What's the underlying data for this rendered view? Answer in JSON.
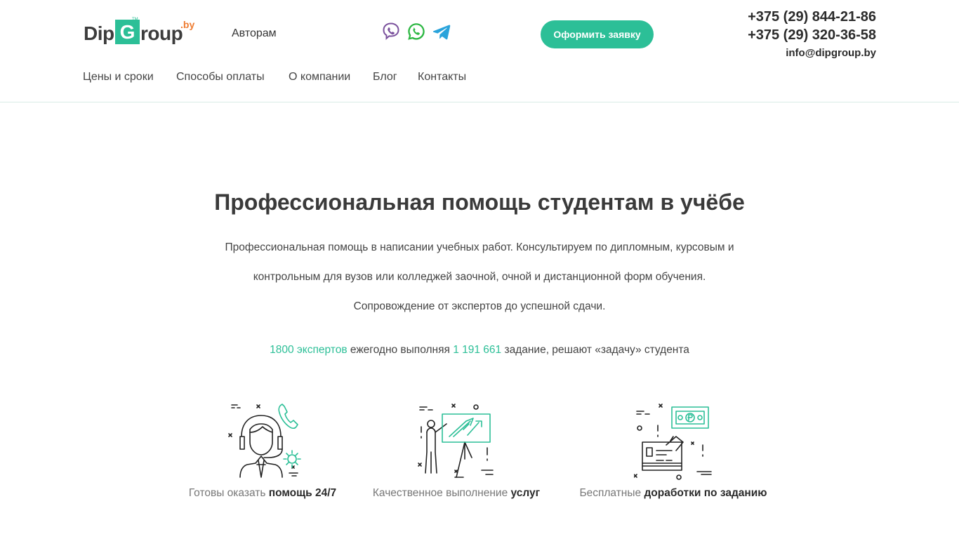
{
  "logo": {
    "part1": "Dip",
    "letter": "G",
    "registered": "TM",
    "part2": "roup",
    "suffix": ".by"
  },
  "header": {
    "authors_link": "Авторам",
    "order_button": "Оформить заявку",
    "phones": [
      "+375 (29) 844-21-86",
      "+375 (29) 320-36-58"
    ],
    "email": "info@dipgroup.by",
    "messengers": [
      "viber-icon",
      "whatsapp-icon",
      "telegram-icon"
    ]
  },
  "nav": {
    "items": [
      {
        "label": "Цены и сроки"
      },
      {
        "label": "Способы оплаты"
      },
      {
        "label": "О компании"
      },
      {
        "label": "Блог"
      },
      {
        "label": "Контакты"
      }
    ]
  },
  "hero": {
    "title": "Профессиональная помощь студентам в учёбе",
    "text_lines": [
      "Профессиональная помощь в написании учебных работ. Консультируем по дипломным, курсовым и",
      "контрольным для вузов или колледжей заочной, очной и дистанционной форм обучения.",
      "Сопровождение от экспертов до успешной сдачи."
    ]
  },
  "stats": {
    "experts": "1800 экспертов",
    "middle": " ежегодно выполняя ",
    "tasks": "1 191 661",
    "tail": " задание, решают «задачу» студента"
  },
  "features": [
    {
      "icon": "support-operator-icon",
      "prefix": "Готовы оказать ",
      "bold": "помощь 24/7"
    },
    {
      "icon": "presentation-growth-icon",
      "prefix": "Качественное выполнение ",
      "bold": "услуг"
    },
    {
      "icon": "payment-card-icon",
      "prefix": "Бесплатные ",
      "bold": "доработки по заданию"
    }
  ],
  "colors": {
    "accent": "#2cbf97",
    "logo_suffix": "#ee7b30",
    "viber": "#7b519d",
    "whatsapp": "#2cb742",
    "telegram": "#2aa3db"
  }
}
